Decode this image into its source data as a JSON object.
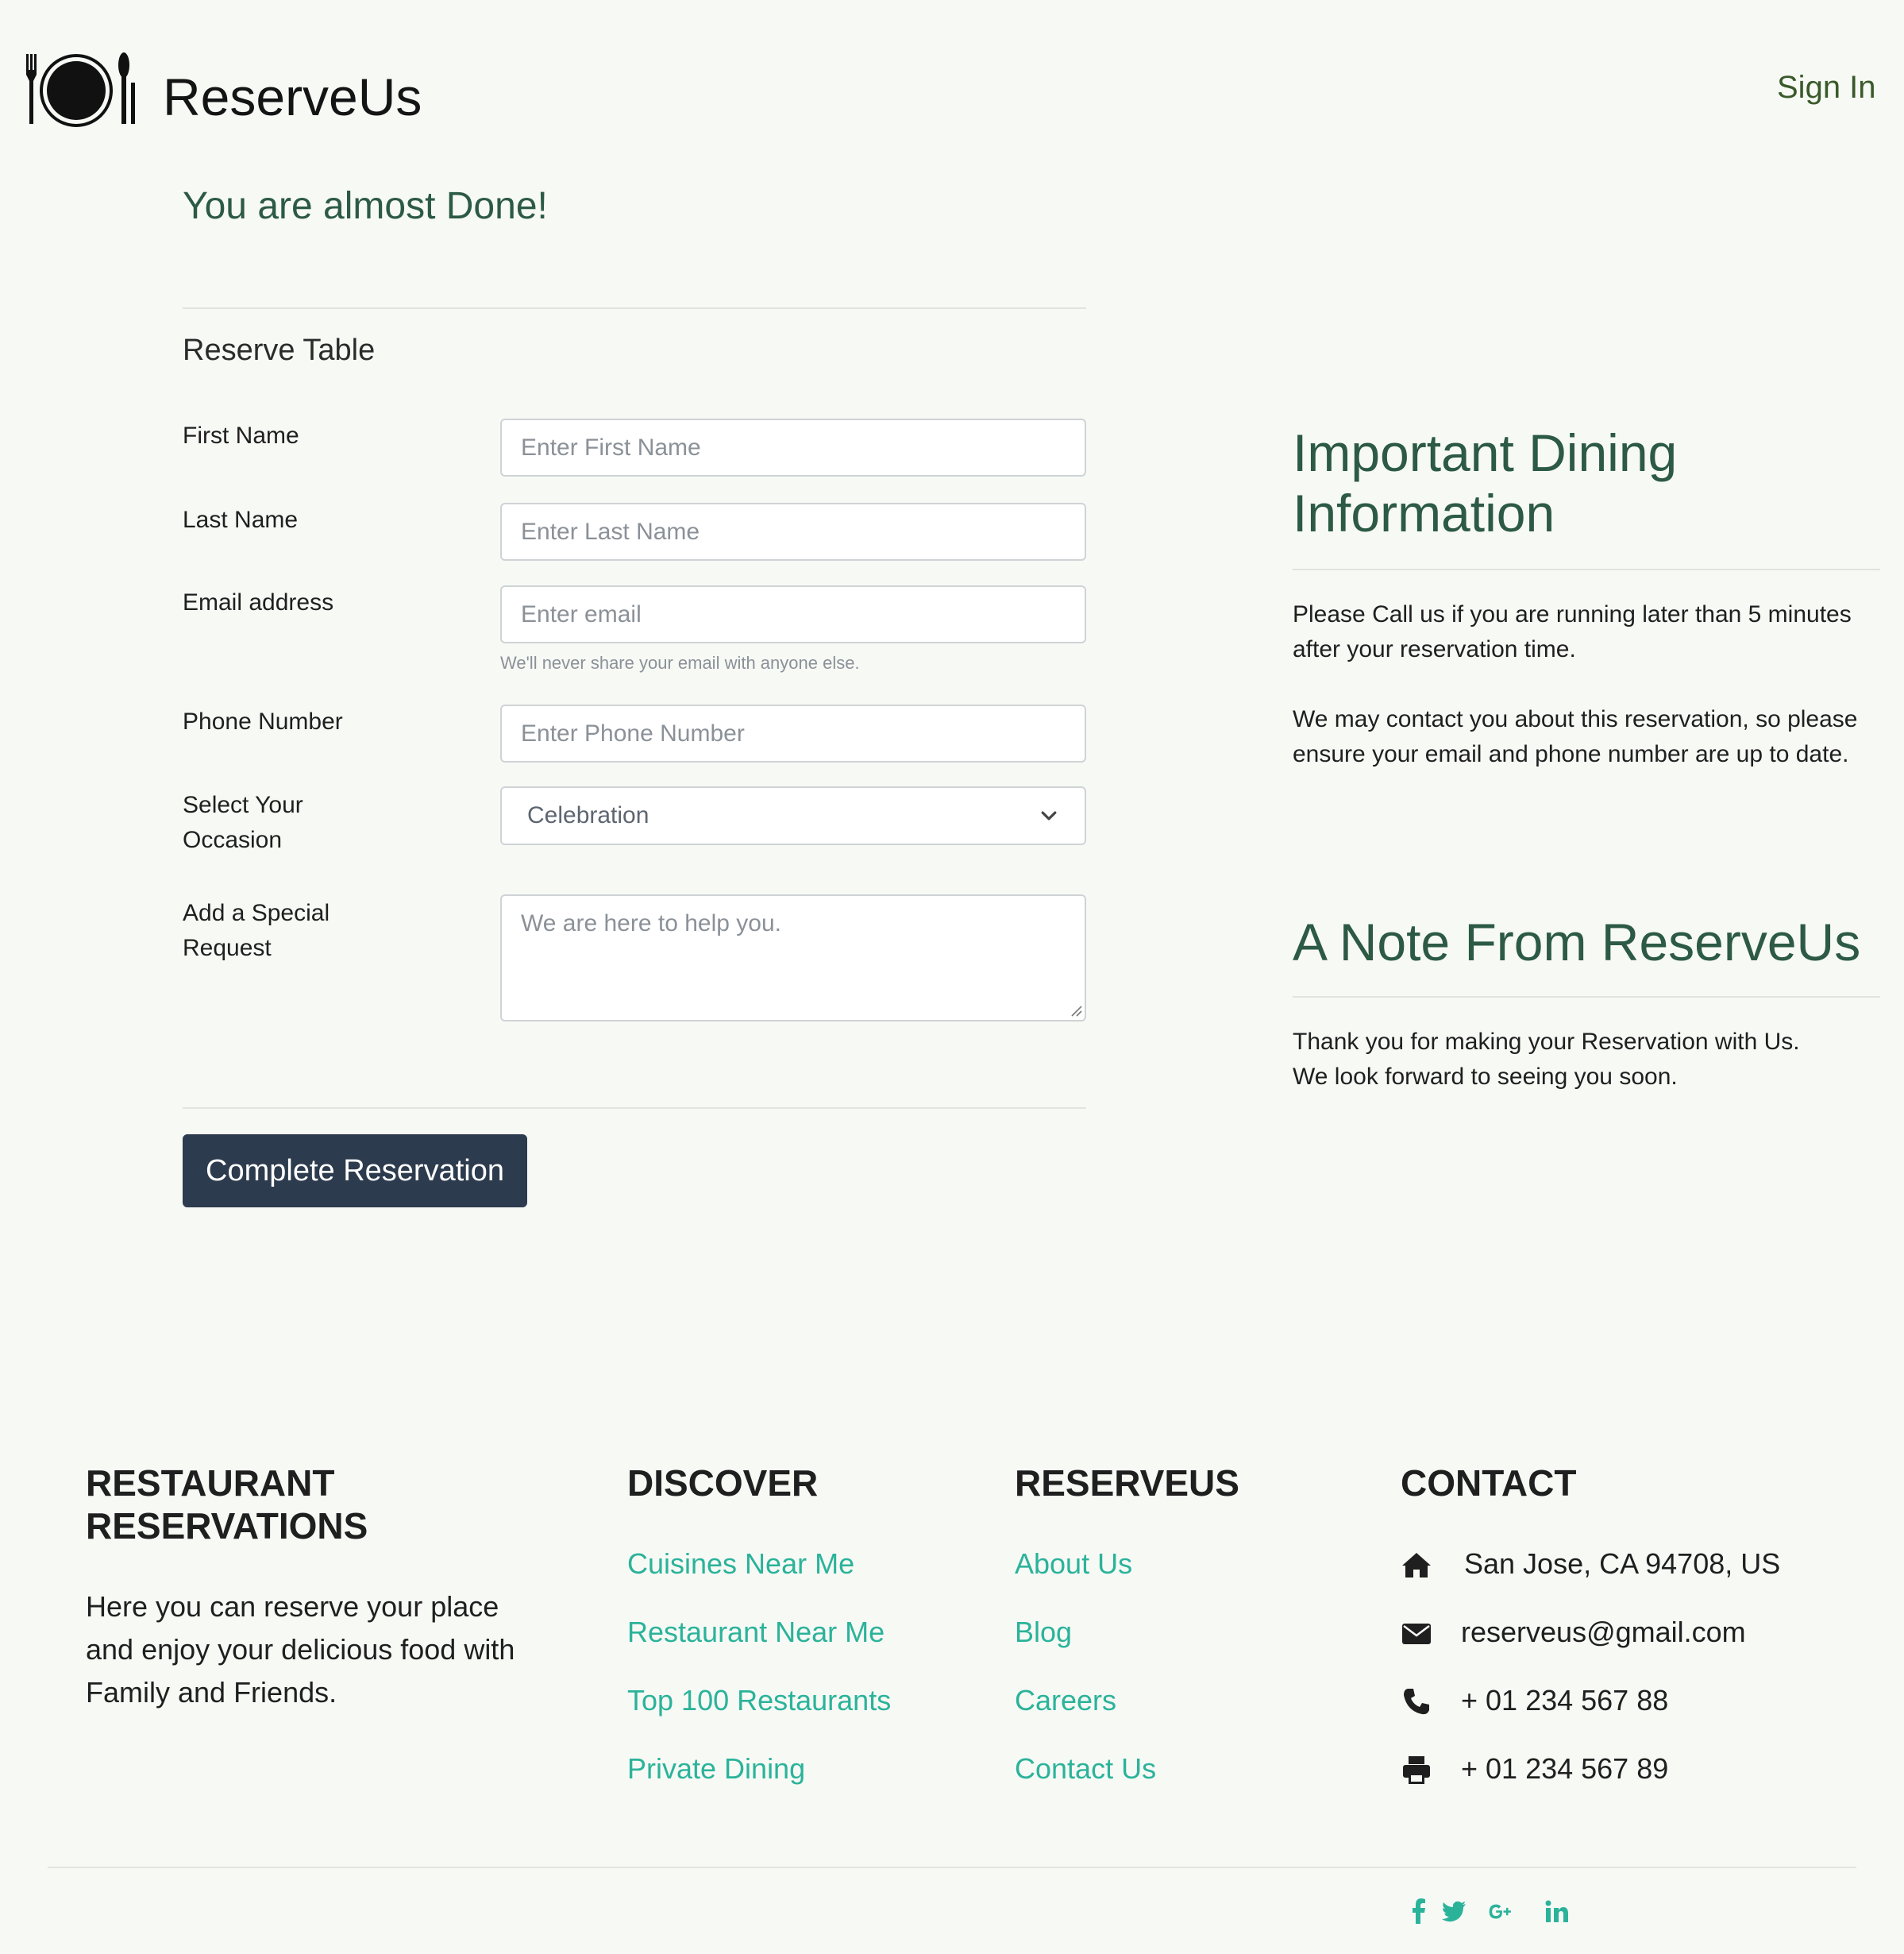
{
  "header": {
    "brand": "ReserveUs",
    "sign_in": "Sign In"
  },
  "form": {
    "heading": "You are almost Done!",
    "section_title": "Reserve Table",
    "first_name": {
      "label": "First Name",
      "placeholder": "Enter First Name",
      "value": ""
    },
    "last_name": {
      "label": "Last Name",
      "placeholder": "Enter Last Name",
      "value": ""
    },
    "email": {
      "label": "Email address",
      "placeholder": "Enter email",
      "value": "",
      "help": "We'll never share your email with anyone else."
    },
    "phone": {
      "label": "Phone Number",
      "placeholder": "Enter Phone Number",
      "value": ""
    },
    "occasion": {
      "label_line1": "Select Your",
      "label_line2": "Occasion",
      "selected": "Celebration"
    },
    "special_request": {
      "label_line1": "Add a Special",
      "label_line2": "Request",
      "placeholder": "We are here to help you."
    },
    "submit": "Complete Reservation"
  },
  "info": {
    "important_heading_line1": "Important Dining",
    "important_heading_line2": "Information",
    "important_p1": "Please Call us if you are running later than 5 minutes after your reservation time.",
    "important_p2": "We may contact you about this reservation, so please ensure your email and phone number are up to date.",
    "note_heading": "A Note From ReserveUs",
    "note_line1": "Thank you for making your Reservation with Us.",
    "note_line2": "We look forward to seeing you soon."
  },
  "footer": {
    "col1": {
      "heading_line1": "RESTAURANT",
      "heading_line2": "RESERVATIONS",
      "text": "Here you can reserve your place and enjoy your delicious food with Family and Friends."
    },
    "discover": {
      "heading": "DISCOVER",
      "links": [
        "Cuisines Near Me",
        "Restaurant Near Me",
        "Top 100 Restaurants",
        "Private Dining"
      ]
    },
    "reserveus": {
      "heading": "RESERVEUS",
      "links": [
        "About Us",
        "Blog",
        "Careers",
        "Contact Us"
      ]
    },
    "contact": {
      "heading": "CONTACT",
      "address": "San Jose, CA 94708, US",
      "email": "reserveus@gmail.com",
      "phone": "+ 01 234 567 88",
      "fax": "+ 01 234 567 89",
      "icons": [
        "home-icon",
        "envelope-icon",
        "phone-icon",
        "print-icon"
      ]
    },
    "social_icons": [
      "facebook-icon",
      "twitter-icon",
      "google-plus-icon",
      "linkedin-icon"
    ]
  },
  "colors": {
    "background": "#f7f9f5",
    "heading_green": "#2c5a44",
    "link_teal": "#2bb39a",
    "button": "#2d3b4e"
  }
}
